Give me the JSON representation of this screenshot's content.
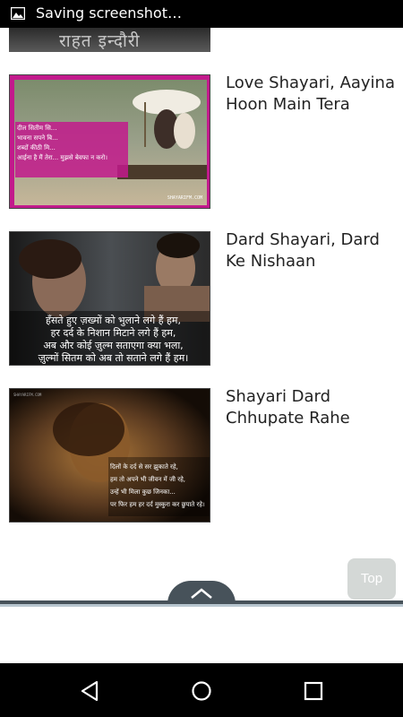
{
  "status_bar": {
    "notification_text": "Saving screenshot…",
    "icon": "image-icon"
  },
  "top_partial_item": {
    "thumbnail_text": "राहत इन्दौरी"
  },
  "items": [
    {
      "title": "Love Shayari, Aayina Hoon Main Tera",
      "thumbnail_lines": [
        "दील सितीम सि...",
        "भावना सपने बि...",
        "शब्दों कीठी मि...",
        "आईना है मैं तेरा... मुझसे बेवफा न करो।"
      ],
      "thumbnail_watermark": "SHAYARIFM.COM"
    },
    {
      "title": "Dard Shayari, Dard Ke Nishaan",
      "thumbnail_lines": [
        "हँसते हुए ज़ख्मों को भुलाने लगे हैं हम,",
        "हर दर्द के निशान मिटाने लगे हैं हम,",
        "अब और कोई ज़ुल्म सताएगा क्या भला,",
        "ज़ुल्मों सितम को अब तो सताने लगे हैं हम।"
      ]
    },
    {
      "title": "Shayari Dard Chhupate Rahe",
      "thumbnail_lines": [
        "दिलों के दर्द से सर झुकाते रहे,",
        "हम तो अपने भी जीवन में जी रहे,",
        "उन्हें भी मिला कुछ जिनका...",
        "पर फिर हम हर दर्द मुस्कुरा कर छुपाते रहे।"
      ],
      "thumbnail_watermark": "SHAYARIFM.COM"
    }
  ],
  "scroll_top_button": {
    "label": "Top"
  },
  "dock": {
    "icon": "chevron-up-icon"
  },
  "nav_bar": {
    "back_icon": "back-triangle-icon",
    "home_icon": "home-circle-icon",
    "recents_icon": "recents-square-icon"
  }
}
